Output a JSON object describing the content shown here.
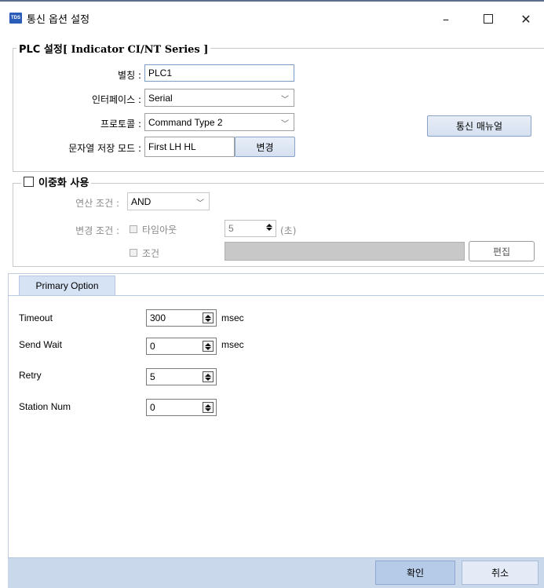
{
  "window": {
    "icon_text": "TDS",
    "title": "통신 옵션 설정",
    "minimize": "–",
    "close": "✕"
  },
  "plc_group": {
    "legend_prefix": "PLC 설정",
    "legend_series": "[ Indicator CI/NT Series ]",
    "alias_label": "별칭 :",
    "alias_value": "PLC1",
    "interface_label": "인터페이스 :",
    "interface_value": "Serial",
    "protocol_label": "프로토콜 :",
    "protocol_value": "Command Type 2",
    "string_mode_label": "문자열 저장 모드 :",
    "string_mode_value": "First LH HL",
    "change_button": "변경",
    "manual_button": "통신 매뉴얼"
  },
  "redundancy": {
    "checkbox_label": "이중화 사용",
    "checked": false,
    "operation_label": "연산 조건 :",
    "operation_value": "AND",
    "change_cond_label": "변경 조건 :",
    "timeout_check_label": "타임아웃",
    "timeout_value": "5",
    "timeout_unit": "(초)",
    "condition_check_label": "조건",
    "edit_button": "편집"
  },
  "primary_option": {
    "tab_label": "Primary Option",
    "fields": [
      {
        "label": "Timeout",
        "value": "300",
        "unit": "msec"
      },
      {
        "label": "Send Wait",
        "value": "0",
        "unit": "msec"
      },
      {
        "label": "Retry",
        "value": "5",
        "unit": ""
      },
      {
        "label": "Station Num",
        "value": "0",
        "unit": ""
      }
    ]
  },
  "footer": {
    "ok_button": "확인",
    "cancel_button": "취소"
  },
  "colors": {
    "accent_blue": "#2a5db8",
    "footer_bg": "#cad8ec",
    "tab_bg": "#d6e3f4"
  }
}
